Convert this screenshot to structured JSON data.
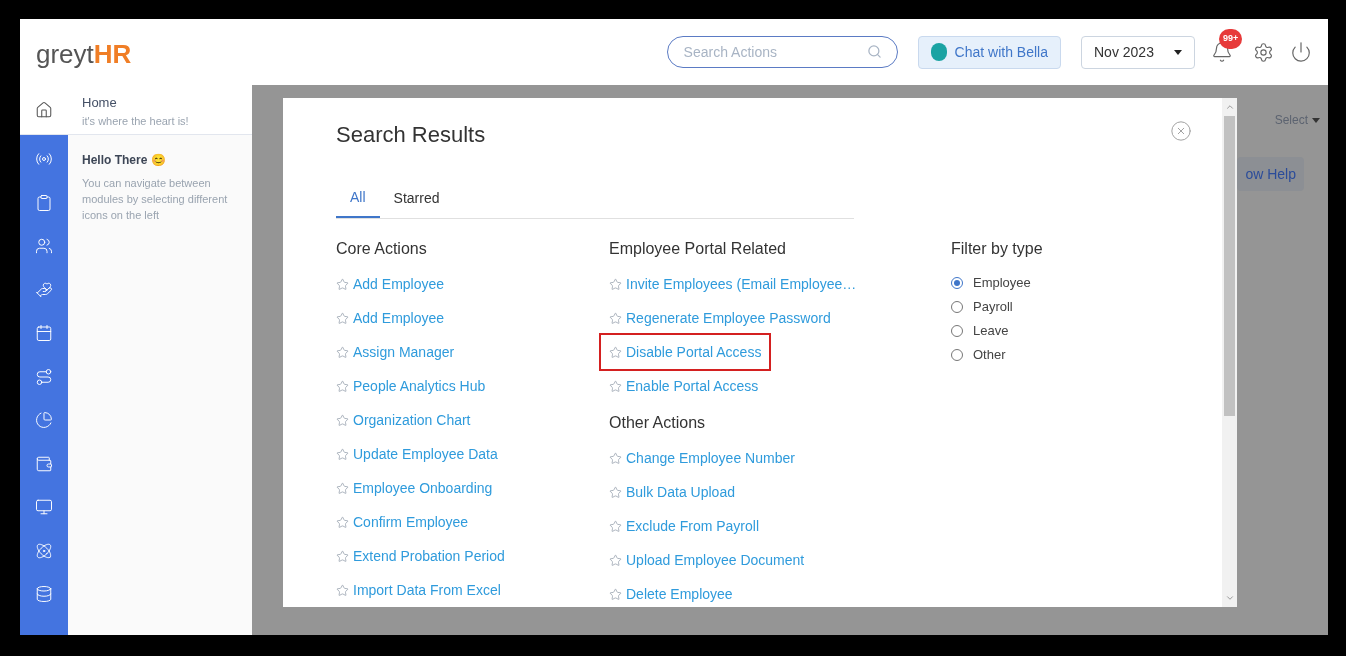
{
  "header": {
    "logo": {
      "grey": "greyt",
      "hr": "HR"
    },
    "search": {
      "placeholder": "Search Actions"
    },
    "chat_button": "Chat with Bella",
    "month_select": "Nov 2023",
    "notification_badge": "99+"
  },
  "sidebar": {
    "home": {
      "title": "Home",
      "subtitle": "it's where the heart is!"
    },
    "greeting": {
      "title": "Hello There",
      "emoji": "😊",
      "text": "You can navigate between modules by selecting different icons on the left"
    }
  },
  "background": {
    "select": "Select",
    "help_button": "ow Help"
  },
  "modal": {
    "title": "Search Results",
    "tabs": [
      {
        "label": "All",
        "selected": true
      },
      {
        "label": "Starred",
        "selected": false
      }
    ],
    "core_actions": {
      "heading": "Core Actions",
      "items": [
        {
          "label": "Add Employee",
          "highlighted": false
        },
        {
          "label": "Add Employee",
          "highlighted": false
        },
        {
          "label": "Assign Manager",
          "highlighted": false
        },
        {
          "label": "People Analytics Hub",
          "highlighted": false
        },
        {
          "label": "Organization Chart",
          "highlighted": false
        },
        {
          "label": "Update Employee Data",
          "highlighted": false
        },
        {
          "label": "Employee Onboarding",
          "highlighted": false
        },
        {
          "label": "Confirm Employee",
          "highlighted": false
        },
        {
          "label": "Extend Probation Period",
          "highlighted": false
        },
        {
          "label": "Import Data From Excel",
          "highlighted": false
        }
      ]
    },
    "portal_actions": {
      "heading": "Employee Portal Related",
      "items": [
        {
          "label": "Invite Employees (Email Employee…",
          "highlighted": false
        },
        {
          "label": "Regenerate Employee Password",
          "highlighted": false
        },
        {
          "label": "Disable Portal Access",
          "highlighted": true
        },
        {
          "label": "Enable Portal Access",
          "highlighted": false
        }
      ]
    },
    "other_actions": {
      "heading": "Other Actions",
      "items": [
        {
          "label": "Change Employee Number",
          "highlighted": false
        },
        {
          "label": "Bulk Data Upload",
          "highlighted": false
        },
        {
          "label": "Exclude From Payroll",
          "highlighted": false
        },
        {
          "label": "Upload Employee Document",
          "highlighted": false
        },
        {
          "label": "Delete Employee",
          "highlighted": false
        }
      ]
    },
    "filter": {
      "heading": "Filter by type",
      "options": [
        {
          "label": "Employee",
          "selected": true
        },
        {
          "label": "Payroll",
          "selected": false
        },
        {
          "label": "Leave",
          "selected": false
        },
        {
          "label": "Other",
          "selected": false
        }
      ]
    }
  }
}
